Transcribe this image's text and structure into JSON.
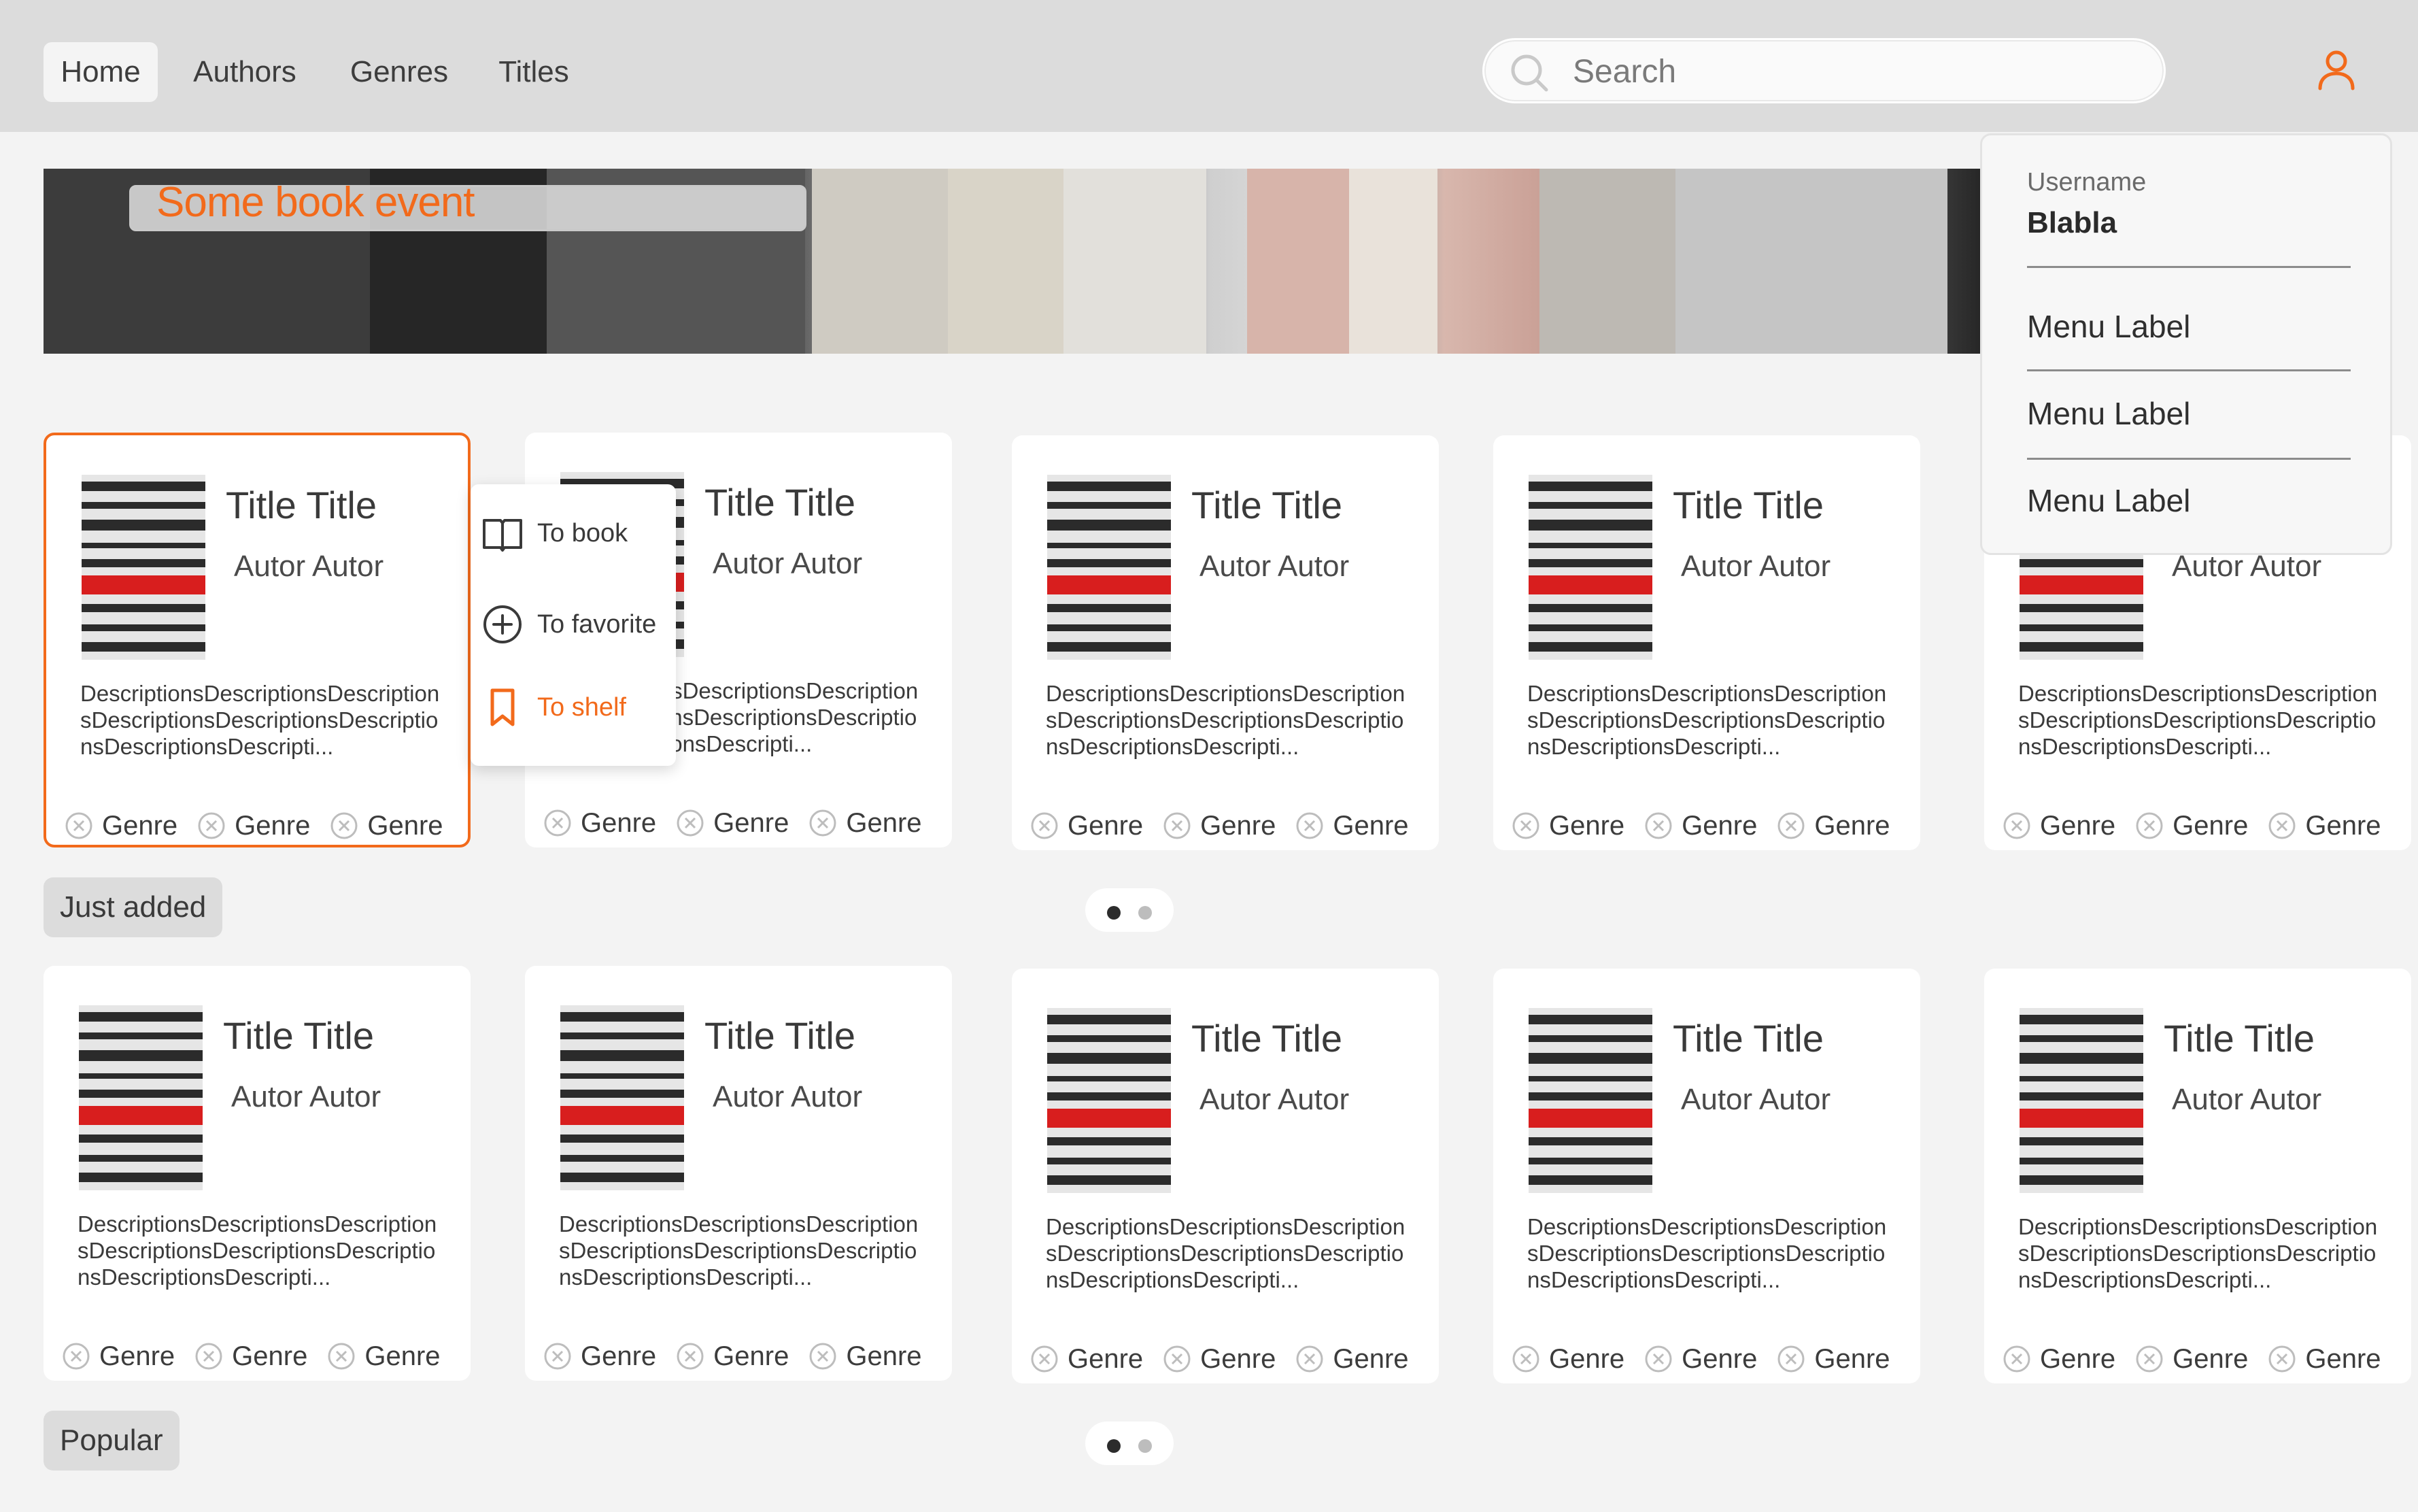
{
  "nav": {
    "items": [
      {
        "label": "Home",
        "active": true
      },
      {
        "label": "Authors",
        "active": false
      },
      {
        "label": "Genres",
        "active": false
      },
      {
        "label": "Titles",
        "active": false
      }
    ]
  },
  "search": {
    "placeholder": "Search",
    "value": ""
  },
  "banner": {
    "title": "Some book event"
  },
  "colors": {
    "accent": "#f26a1b",
    "header_bg": "#dcdcdc",
    "page_bg": "#f3f3f3"
  },
  "card_template": {
    "title": "Title Title",
    "author": "Autor Autor",
    "description": "DescriptionsDescriptionsDescriptionsDescriptionsDescriptionsDescriptionsDescriptionsDescripti...",
    "genres": [
      "Genre",
      "Genre",
      "Genre"
    ]
  },
  "sections": [
    {
      "label": "Just added",
      "page_count": 2,
      "current_page": 1
    },
    {
      "label": "Popular",
      "page_count": 2,
      "current_page": 1
    }
  ],
  "card_menu": {
    "items": [
      {
        "label": "To book",
        "icon": "open-book-icon",
        "accent": false
      },
      {
        "label": "To favorite",
        "icon": "plus-circle-icon",
        "accent": false
      },
      {
        "label": "To shelf",
        "icon": "bookmark-icon",
        "accent": true
      }
    ]
  },
  "user_menu": {
    "username_label": "Username",
    "username": "Blabla",
    "items": [
      "Menu Label",
      "Menu Label",
      "Menu Label"
    ]
  },
  "icons": {
    "search": "search-icon",
    "user": "user-icon",
    "genre_remove": "close-circle-icon"
  }
}
